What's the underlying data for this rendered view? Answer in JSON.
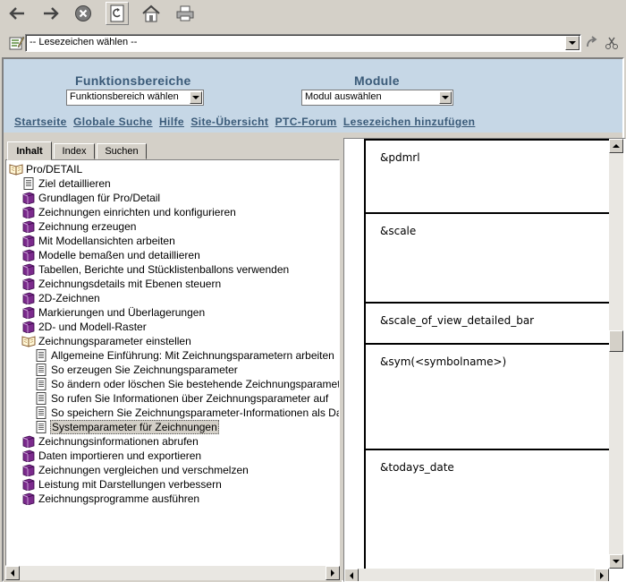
{
  "toolbar": {
    "buttons": [
      "back-arrow",
      "forward-arrow",
      "stop",
      "refresh",
      "home",
      "print"
    ]
  },
  "bookmarks": {
    "select_value": "-- Lesezeichen wählen --"
  },
  "header": {
    "functions_label": "Funktionsbereiche",
    "functions_select": "Funktionsbereich wählen",
    "modules_label": "Module",
    "modules_select": "Modul auswählen",
    "links": [
      "Startseite",
      "Globale Suche",
      "Hilfe",
      "Site-Übersicht",
      "PTC-Forum",
      "Lesezeichen hinzufügen"
    ]
  },
  "tabs": [
    "Inhalt",
    "Index",
    "Suchen"
  ],
  "tree": [
    {
      "label": "Pro/DETAIL",
      "icon": "open-book",
      "level": 0
    },
    {
      "label": "Ziel detaillieren",
      "icon": "page",
      "level": 1
    },
    {
      "label": "Grundlagen für Pro/Detail",
      "icon": "book",
      "level": 1
    },
    {
      "label": "Zeichnungen einrichten und konfigurieren",
      "icon": "book",
      "level": 1
    },
    {
      "label": "Zeichnung erzeugen",
      "icon": "book",
      "level": 1
    },
    {
      "label": "Mit Modellansichten arbeiten",
      "icon": "book",
      "level": 1
    },
    {
      "label": "Modelle bemaßen und detaillieren",
      "icon": "book",
      "level": 1
    },
    {
      "label": "Tabellen, Berichte und Stücklistenballons verwenden",
      "icon": "book",
      "level": 1
    },
    {
      "label": "Zeichnungsdetails mit Ebenen steuern",
      "icon": "book",
      "level": 1
    },
    {
      "label": "2D-Zeichnen",
      "icon": "book",
      "level": 1
    },
    {
      "label": "Markierungen und Überlagerungen",
      "icon": "book",
      "level": 1
    },
    {
      "label": "2D- und Modell-Raster",
      "icon": "book",
      "level": 1
    },
    {
      "label": "Zeichnungsparameter einstellen",
      "icon": "open-book",
      "level": 1
    },
    {
      "label": "Allgemeine Einführung: Mit Zeichnungsparametern arbeiten",
      "icon": "page",
      "level": 2
    },
    {
      "label": "So erzeugen Sie Zeichnungsparameter",
      "icon": "page",
      "level": 2
    },
    {
      "label": "So ändern oder löschen Sie bestehende Zeichnungsparameter",
      "icon": "page",
      "level": 2
    },
    {
      "label": "So rufen Sie Informationen über Zeichnungsparameter auf",
      "icon": "page",
      "level": 2
    },
    {
      "label": "So speichern Sie Zeichnungsparameter-Informationen als Datei",
      "icon": "page",
      "level": 2
    },
    {
      "label": "Systemparameter für Zeichnungen",
      "icon": "page",
      "level": 2,
      "selected": true
    },
    {
      "label": "Zeichnungsinformationen abrufen",
      "icon": "book",
      "level": 1
    },
    {
      "label": "Daten importieren und exportieren",
      "icon": "book",
      "level": 1
    },
    {
      "label": "Zeichnungen vergleichen und verschmelzen",
      "icon": "book",
      "level": 1
    },
    {
      "label": "Leistung mit Darstellungen verbessern",
      "icon": "book",
      "level": 1
    },
    {
      "label": "Zeichnungsprogramme ausführen",
      "icon": "book",
      "level": 1
    }
  ],
  "params": [
    "&pdmrl",
    "&scale",
    "&scale_of_view_detailed_bar",
    "&sym(<symbolname>)",
    "&todays_date"
  ]
}
